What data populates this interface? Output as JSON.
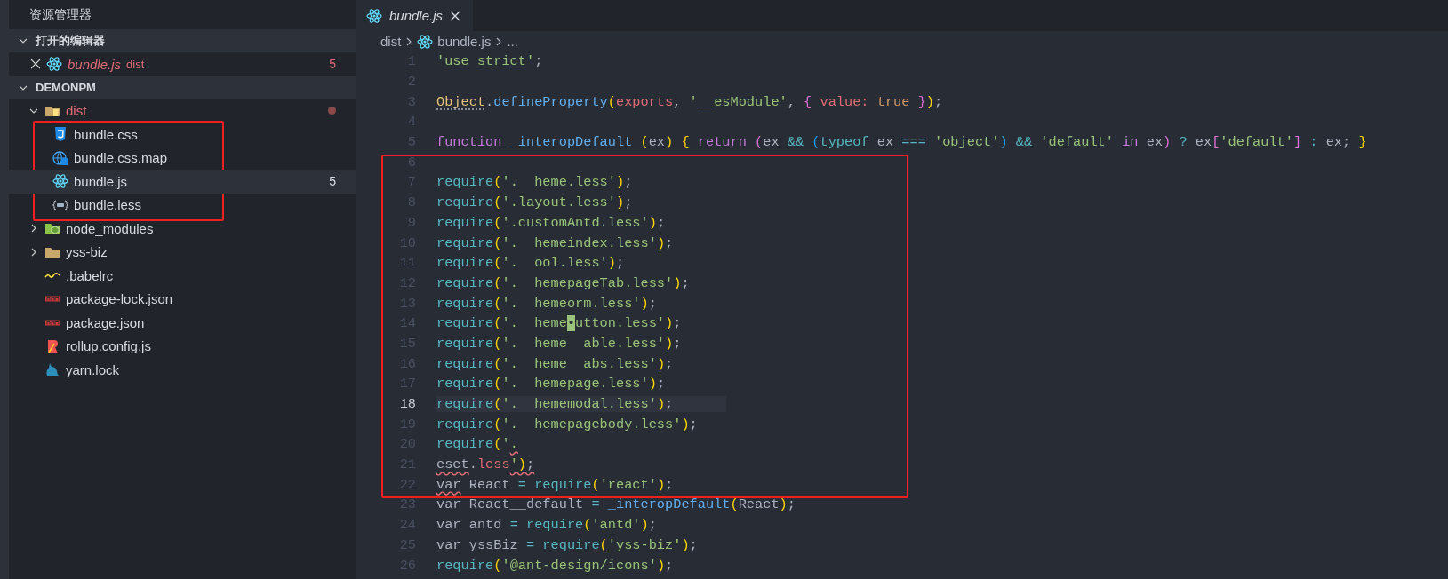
{
  "sidebar": {
    "title": "资源管理器",
    "open_editors": {
      "label": "打开的编辑器",
      "expanded": true,
      "items": [
        {
          "name": "bundle.js",
          "folder": "dist",
          "kind": "react",
          "error": true,
          "badge": "5",
          "selected": false
        }
      ]
    },
    "project": {
      "label": "DEMONPM",
      "expanded": true,
      "tree": [
        {
          "name": "dist",
          "kind": "dist",
          "folder": true,
          "expanded": true,
          "error": true,
          "dot": true,
          "selected": false,
          "children": [
            {
              "name": "bundle.css",
              "kind": "css",
              "selected": false
            },
            {
              "name": "bundle.css.map",
              "kind": "sourcemap",
              "selected": false
            },
            {
              "name": "bundle.js",
              "kind": "react",
              "badge": "5",
              "selected": true
            },
            {
              "name": "bundle.less",
              "kind": "less",
              "selected": false
            }
          ]
        },
        {
          "name": "node_modules",
          "kind": "modules",
          "folder": true,
          "expanded": false,
          "selected": false
        },
        {
          "name": "yss-biz",
          "kind": "folder",
          "folder": true,
          "expanded": false,
          "selected": false
        },
        {
          "name": ".babelrc",
          "kind": "babel",
          "selected": false
        },
        {
          "name": "package-lock.json",
          "kind": "npm",
          "selected": false
        },
        {
          "name": "package.json",
          "kind": "npm",
          "selected": false
        },
        {
          "name": "rollup.config.js",
          "kind": "rollup",
          "selected": false
        },
        {
          "name": "yarn.lock",
          "kind": "yarn",
          "selected": false
        }
      ]
    }
  },
  "tabs": [
    {
      "label": "bundle.js",
      "kind": "react",
      "preview": true,
      "selected": true
    }
  ],
  "breadcrumb": [
    {
      "kind": "folder",
      "label": "dist"
    },
    {
      "kind": "react",
      "label": "bundle.js"
    },
    {
      "kind": "more",
      "label": "..."
    }
  ],
  "code": {
    "lines": [
      {
        "number": "1",
        "current": false,
        "tokens": [
          {
            "text": "'use strict'",
            "kind": "str"
          },
          {
            "text": ";",
            "kind": "punc"
          }
        ]
      },
      {
        "number": "2",
        "current": false
      },
      {
        "number": "3",
        "current": false,
        "tokens": [
          {
            "text": "Object",
            "kind": "cls",
            "hint": true
          },
          {
            "text": ".",
            "kind": "punc"
          },
          {
            "text": "defineProperty",
            "kind": "fn"
          },
          {
            "text": "(",
            "kind": "p1"
          },
          {
            "text": "exports",
            "kind": "param"
          },
          {
            "text": ", ",
            "kind": "punc"
          },
          {
            "text": "'__esModule'",
            "kind": "str"
          },
          {
            "text": ", ",
            "kind": "punc"
          },
          {
            "text": "{",
            "kind": "p2"
          },
          {
            "text": " value: ",
            "kind": "param"
          },
          {
            "text": "true ",
            "kind": "bool"
          },
          {
            "text": "}",
            "kind": "p2"
          },
          {
            "text": ")",
            "kind": "p1"
          },
          {
            "text": ";",
            "kind": "punc"
          }
        ]
      },
      {
        "number": "4",
        "current": false
      },
      {
        "number": "5",
        "current": false,
        "tokens": [
          {
            "text": "function ",
            "kind": "kw"
          },
          {
            "text": "_interopDefault ",
            "kind": "fn"
          },
          {
            "text": "(",
            "kind": "p1"
          },
          {
            "text": "ex",
            "kind": "var"
          },
          {
            "text": ") ",
            "kind": "p1"
          },
          {
            "text": "{",
            "kind": "p1"
          },
          {
            "text": " return ",
            "kind": "kw"
          },
          {
            "text": "(",
            "kind": "p2"
          },
          {
            "text": "ex ",
            "kind": "var"
          },
          {
            "text": "&& ",
            "kind": "op"
          },
          {
            "text": "(",
            "kind": "p3"
          },
          {
            "text": "typeof",
            "kind": "op"
          },
          {
            "text": " ex ",
            "kind": "var"
          },
          {
            "text": "=== ",
            "kind": "op"
          },
          {
            "text": "'object'",
            "kind": "str"
          },
          {
            "text": ") ",
            "kind": "p3"
          },
          {
            "text": "&& ",
            "kind": "op"
          },
          {
            "text": "'default'",
            "kind": "str"
          },
          {
            "text": " in ",
            "kind": "kw"
          },
          {
            "text": "ex",
            "kind": "var"
          },
          {
            "text": ") ",
            "kind": "p2"
          },
          {
            "text": "?",
            "kind": "op"
          },
          {
            "text": " ex",
            "kind": "var"
          },
          {
            "text": "[",
            "kind": "p2"
          },
          {
            "text": "'default'",
            "kind": "str"
          },
          {
            "text": "] ",
            "kind": "p2"
          },
          {
            "text": ": ",
            "kind": "op"
          },
          {
            "text": "ex; ",
            "kind": "var"
          },
          {
            "text": "}",
            "kind": "p1"
          }
        ]
      },
      {
        "number": "6",
        "current": false
      },
      {
        "number": "7",
        "current": false,
        "tokens": [
          {
            "text": "require",
            "kind": "call"
          },
          {
            "text": "(",
            "kind": "p1"
          },
          {
            "text": "'.  heme.less'",
            "kind": "str"
          },
          {
            "text": ")",
            "kind": "p1"
          },
          {
            "text": ";",
            "kind": "punc"
          }
        ]
      },
      {
        "number": "8",
        "current": false,
        "tokens": [
          {
            "text": "require",
            "kind": "call"
          },
          {
            "text": "(",
            "kind": "p1"
          },
          {
            "text": "'.layout.less'",
            "kind": "str"
          },
          {
            "text": ")",
            "kind": "p1"
          },
          {
            "text": ";",
            "kind": "punc"
          }
        ]
      },
      {
        "number": "9",
        "current": false,
        "tokens": [
          {
            "text": "require",
            "kind": "call"
          },
          {
            "text": "(",
            "kind": "p1"
          },
          {
            "text": "'.customAntd.less'",
            "kind": "str"
          },
          {
            "text": ")",
            "kind": "p1"
          },
          {
            "text": ";",
            "kind": "punc"
          }
        ]
      },
      {
        "number": "10",
        "current": false,
        "tokens": [
          {
            "text": "require",
            "kind": "call"
          },
          {
            "text": "(",
            "kind": "p1"
          },
          {
            "text": "'.  hemeindex.less'",
            "kind": "str"
          },
          {
            "text": ")",
            "kind": "p1"
          },
          {
            "text": ";",
            "kind": "punc"
          }
        ]
      },
      {
        "number": "11",
        "current": false,
        "tokens": [
          {
            "text": "require",
            "kind": "call"
          },
          {
            "text": "(",
            "kind": "p1"
          },
          {
            "text": "'.  ool.less'",
            "kind": "str"
          },
          {
            "text": ")",
            "kind": "p1"
          },
          {
            "text": ";",
            "kind": "punc"
          }
        ]
      },
      {
        "number": "12",
        "current": false,
        "tokens": [
          {
            "text": "require",
            "kind": "call"
          },
          {
            "text": "(",
            "kind": "p1"
          },
          {
            "text": "'.  hemepageTab.less'",
            "kind": "str"
          },
          {
            "text": ")",
            "kind": "p1"
          },
          {
            "text": ";",
            "kind": "punc"
          }
        ]
      },
      {
        "number": "13",
        "current": false,
        "tokens": [
          {
            "text": "require",
            "kind": "call"
          },
          {
            "text": "(",
            "kind": "p1"
          },
          {
            "text": "'.  hemeorm.less'",
            "kind": "str"
          },
          {
            "text": ")",
            "kind": "p1"
          },
          {
            "text": ";",
            "kind": "punc"
          }
        ]
      },
      {
        "number": "14",
        "current": false,
        "tokens": [
          {
            "text": "require",
            "kind": "call"
          },
          {
            "text": "(",
            "kind": "p1"
          },
          {
            "text": "'.  heme",
            "kind": "str"
          },
          {
            "text": "•",
            "kind": "cursor"
          },
          {
            "text": "utton.less'",
            "kind": "str"
          },
          {
            "text": ")",
            "kind": "p1"
          },
          {
            "text": ";",
            "kind": "punc"
          }
        ]
      },
      {
        "number": "15",
        "current": false,
        "tokens": [
          {
            "text": "require",
            "kind": "call"
          },
          {
            "text": "(",
            "kind": "p1"
          },
          {
            "text": "'.  heme  able.less'",
            "kind": "str"
          },
          {
            "text": ")",
            "kind": "p1"
          },
          {
            "text": ";",
            "kind": "punc"
          }
        ]
      },
      {
        "number": "16",
        "current": false,
        "tokens": [
          {
            "text": "require",
            "kind": "call"
          },
          {
            "text": "(",
            "kind": "p1"
          },
          {
            "text": "'.  heme  abs.less'",
            "kind": "str"
          },
          {
            "text": ")",
            "kind": "p1"
          },
          {
            "text": ";",
            "kind": "punc"
          }
        ]
      },
      {
        "number": "17",
        "current": false,
        "tokens": [
          {
            "text": "require",
            "kind": "call"
          },
          {
            "text": "(",
            "kind": "p1"
          },
          {
            "text": "'.  hemepage.less'",
            "kind": "str"
          },
          {
            "text": ")",
            "kind": "p1"
          },
          {
            "text": ";",
            "kind": "punc"
          }
        ]
      },
      {
        "number": "18",
        "current": true,
        "tokens": [
          {
            "text": "require",
            "kind": "call"
          },
          {
            "text": "(",
            "kind": "p1"
          },
          {
            "text": "'.  hememodal.less'",
            "kind": "str"
          },
          {
            "text": ")",
            "kind": "p1"
          },
          {
            "text": ";",
            "kind": "punc"
          }
        ]
      },
      {
        "number": "19",
        "current": false,
        "tokens": [
          {
            "text": "require",
            "kind": "call"
          },
          {
            "text": "(",
            "kind": "p1"
          },
          {
            "text": "'.  hemepagebody.less'",
            "kind": "str"
          },
          {
            "text": ")",
            "kind": "p1"
          },
          {
            "text": ";",
            "kind": "punc"
          }
        ]
      },
      {
        "number": "20",
        "current": false,
        "tokens": [
          {
            "text": "require",
            "kind": "call"
          },
          {
            "text": "(",
            "kind": "p1"
          },
          {
            "text": "'",
            "kind": "str"
          },
          {
            "text": ".",
            "kind": "str",
            "squiggle": true
          }
        ]
      },
      {
        "number": "21",
        "current": false,
        "tokens": [
          {
            "text": "eset",
            "kind": "var",
            "squiggle": true
          },
          {
            "text": ".",
            "kind": "punc"
          },
          {
            "text": "less",
            "kind": "param"
          },
          {
            "text": "'",
            "kind": "str",
            "squiggle": true
          },
          {
            "text": ")",
            "kind": "p1",
            "squiggle": true
          },
          {
            "text": ";",
            "kind": "punc",
            "squiggle": true
          }
        ]
      },
      {
        "number": "22",
        "current": false,
        "tokens": [
          {
            "text": "var",
            "kind": "var",
            "squiggle": true
          },
          {
            "text": " React ",
            "kind": "var"
          },
          {
            "text": "= ",
            "kind": "op"
          },
          {
            "text": "require",
            "kind": "call"
          },
          {
            "text": "(",
            "kind": "p1"
          },
          {
            "text": "'react'",
            "kind": "str"
          },
          {
            "text": ")",
            "kind": "p1"
          },
          {
            "text": ";",
            "kind": "punc"
          }
        ]
      },
      {
        "number": "23",
        "current": false,
        "tokens": [
          {
            "text": "var React__default ",
            "kind": "var"
          },
          {
            "text": "= ",
            "kind": "op"
          },
          {
            "text": "_interopDefault",
            "kind": "fn"
          },
          {
            "text": "(",
            "kind": "p1"
          },
          {
            "text": "React",
            "kind": "var"
          },
          {
            "text": ")",
            "kind": "p1"
          },
          {
            "text": ";",
            "kind": "punc"
          }
        ]
      },
      {
        "number": "24",
        "current": false,
        "tokens": [
          {
            "text": "var antd ",
            "kind": "var"
          },
          {
            "text": "= ",
            "kind": "op"
          },
          {
            "text": "require",
            "kind": "call"
          },
          {
            "text": "(",
            "kind": "p1"
          },
          {
            "text": "'antd'",
            "kind": "str"
          },
          {
            "text": ")",
            "kind": "p1"
          },
          {
            "text": ";",
            "kind": "punc"
          }
        ]
      },
      {
        "number": "25",
        "current": false,
        "tokens": [
          {
            "text": "var yssBiz ",
            "kind": "var"
          },
          {
            "text": "= ",
            "kind": "op"
          },
          {
            "text": "require",
            "kind": "call"
          },
          {
            "text": "(",
            "kind": "p1"
          },
          {
            "text": "'yss-biz'",
            "kind": "str"
          },
          {
            "text": ")",
            "kind": "p1"
          },
          {
            "text": ";",
            "kind": "punc"
          }
        ]
      },
      {
        "number": "26",
        "current": false,
        "tokens": [
          {
            "text": "require",
            "kind": "call"
          },
          {
            "text": "(",
            "kind": "p1"
          },
          {
            "text": "'@ant-design/icons'",
            "kind": "str"
          },
          {
            "text": ")",
            "kind": "p1"
          },
          {
            "text": ";",
            "kind": "punc"
          }
        ]
      }
    ]
  }
}
